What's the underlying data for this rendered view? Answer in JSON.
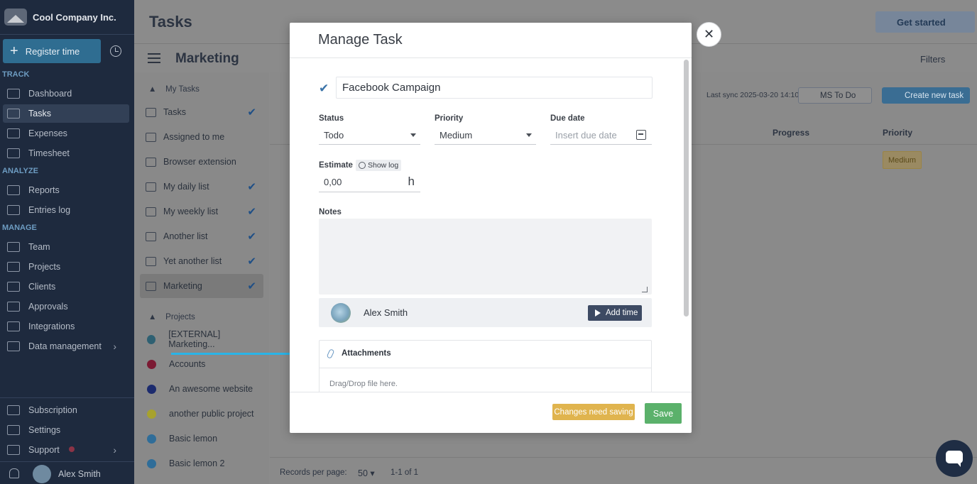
{
  "sidebar": {
    "company": "Cool Company Inc.",
    "register_label": "Register time",
    "sections": {
      "track": "TRACK",
      "analyze": "ANALYZE",
      "manage": "MANAGE"
    },
    "items": [
      {
        "label": "Dashboard",
        "icon": "dashboard-icon"
      },
      {
        "label": "Tasks",
        "icon": "tasks-icon"
      },
      {
        "label": "Expenses",
        "icon": "expenses-icon"
      },
      {
        "label": "Timesheet",
        "icon": "timesheet-icon"
      },
      {
        "label": "Reports",
        "icon": "reports-icon"
      },
      {
        "label": "Entries log",
        "icon": "entries-log-icon"
      },
      {
        "label": "Team",
        "icon": "team-icon"
      },
      {
        "label": "Projects",
        "icon": "projects-icon"
      },
      {
        "label": "Clients",
        "icon": "clients-icon"
      },
      {
        "label": "Approvals",
        "icon": "approvals-icon"
      },
      {
        "label": "Integrations",
        "icon": "integrations-icon"
      },
      {
        "label": "Data management",
        "icon": "data-management-icon"
      },
      {
        "label": "Subscription",
        "icon": "subscription-icon"
      },
      {
        "label": "Settings",
        "icon": "settings-icon"
      },
      {
        "label": "Support",
        "icon": "support-icon"
      }
    ],
    "user_name": "Alex Smith"
  },
  "header": {
    "title": "Tasks",
    "get_started": "Get started",
    "list_title": "Marketing",
    "filters": "Filters"
  },
  "lists": {
    "my_tasks_heading": "My Tasks",
    "my_tasks": [
      {
        "label": "Tasks",
        "checked": true
      },
      {
        "label": "Assigned to me",
        "checked": false
      },
      {
        "label": "Browser extension",
        "checked": false
      },
      {
        "label": "My daily list",
        "checked": true
      },
      {
        "label": "My weekly list",
        "checked": true
      },
      {
        "label": "Another list",
        "checked": true
      },
      {
        "label": "Yet another list",
        "checked": true
      },
      {
        "label": "Marketing",
        "checked": true
      }
    ],
    "projects_heading": "Projects",
    "projects": [
      {
        "label": "[EXTERNAL] Marketing...",
        "color": "#2e6072"
      },
      {
        "label": "Accounts",
        "color": "#7b1a33"
      },
      {
        "label": "An awesome website",
        "color": "#1c2b6e"
      },
      {
        "label": "another public project",
        "color": "#a7a22d"
      },
      {
        "label": "Basic lemon",
        "color": "#2f6d99"
      },
      {
        "label": "Basic lemon 2",
        "color": "#2f6d99"
      }
    ]
  },
  "table": {
    "last_sync": "Last sync 2025-03-20 14:10",
    "integration": "MS To Do",
    "create_new_task": "Create new task",
    "columns": {
      "progress": "Progress",
      "priority": "Priority"
    },
    "row_priority": "Medium",
    "records_per_page_label": "Records per page:",
    "records_per_page": "50",
    "range": "1-1 of 1"
  },
  "modal": {
    "title": "Manage Task",
    "task_title": "Facebook Campaign",
    "status_label": "Status",
    "status_value": "Todo",
    "priority_label": "Priority",
    "priority_value": "Medium",
    "due_date_label": "Due date",
    "due_date_placeholder": "Insert due date",
    "estimate_label": "Estimate",
    "show_log": "Show log",
    "estimate_value": "0,00",
    "estimate_unit": "h",
    "notes_label": "Notes",
    "assignee": "Alex Smith",
    "add_time": "Add time",
    "attachments_label": "Attachments",
    "drop_text": "Drag/Drop file here.",
    "changes_label": "Changes need saving",
    "save_label": "Save"
  },
  "colors": {
    "sidebar_bg": "#1e2a3e",
    "accent_blue": "#3a73a8",
    "save_green": "#5bb16b",
    "warning_yellow": "#e0b44e",
    "annotation_arrow": "#29b4e8"
  }
}
